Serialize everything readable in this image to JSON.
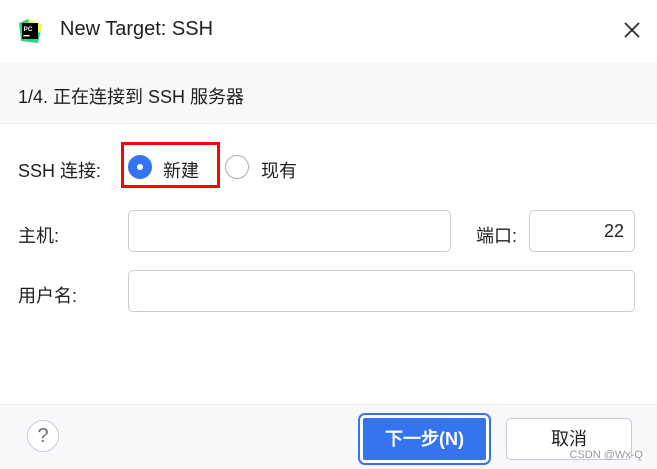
{
  "window": {
    "title": "New Target: SSH",
    "app_icon": "pycharm-logo-icon",
    "close_icon": "close-icon"
  },
  "step": {
    "text": "1/4. 正在连接到 SSH 服务器"
  },
  "ssh_connection": {
    "label": "SSH 连接:",
    "options": [
      {
        "label": "新建",
        "selected": true
      },
      {
        "label": "现有",
        "selected": false
      }
    ]
  },
  "host": {
    "label": "主机:",
    "value": "",
    "placeholder": ""
  },
  "port": {
    "label": "端口:",
    "value": "22"
  },
  "username": {
    "label": "用户名:",
    "value": "",
    "placeholder": ""
  },
  "footer": {
    "help_label": "?",
    "next_label": "下一步(N)",
    "cancel_label": "取消"
  },
  "watermark": "CSDN @Wx-Q",
  "colors": {
    "accent": "#3574f0",
    "highlight": "#ff0000",
    "footer_bg": "#f7f8fa"
  }
}
